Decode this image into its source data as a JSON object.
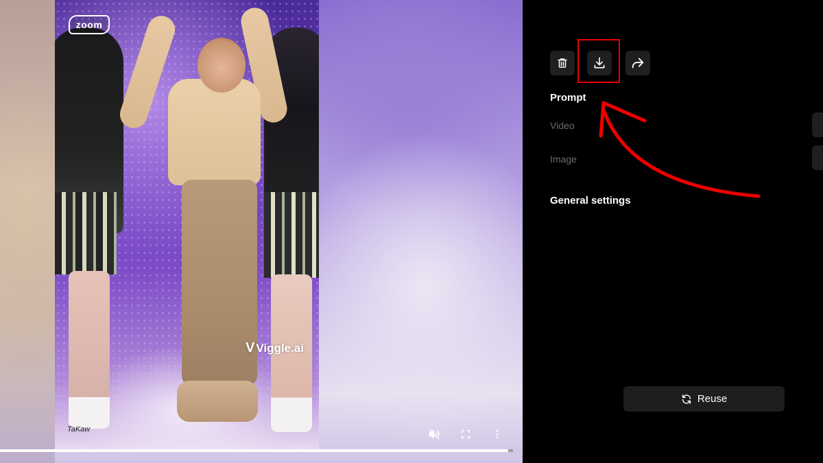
{
  "video": {
    "logo_text": "zoom",
    "watermark_text": "Viggle.ai",
    "watermark_mark": "V",
    "signature_text": "TaKaw",
    "progress": 0.99
  },
  "video_controls": {
    "mute_icon": "volume-muted-icon",
    "fullscreen_icon": "fullscreen-icon",
    "more_icon": "more-vertical-icon"
  },
  "panel": {
    "actions": [
      {
        "name": "delete",
        "icon": "trash-icon"
      },
      {
        "name": "download",
        "icon": "download-icon"
      },
      {
        "name": "share",
        "icon": "share-icon"
      }
    ],
    "prompt_title": "Prompt",
    "video_label": "Video",
    "image_label": "Image",
    "general_settings": "General settings",
    "reuse_label": "Reuse",
    "reuse_icon": "refresh-icon"
  },
  "annotation": {
    "highlight_color": "#e00000",
    "arrow_color": "#e00000"
  }
}
